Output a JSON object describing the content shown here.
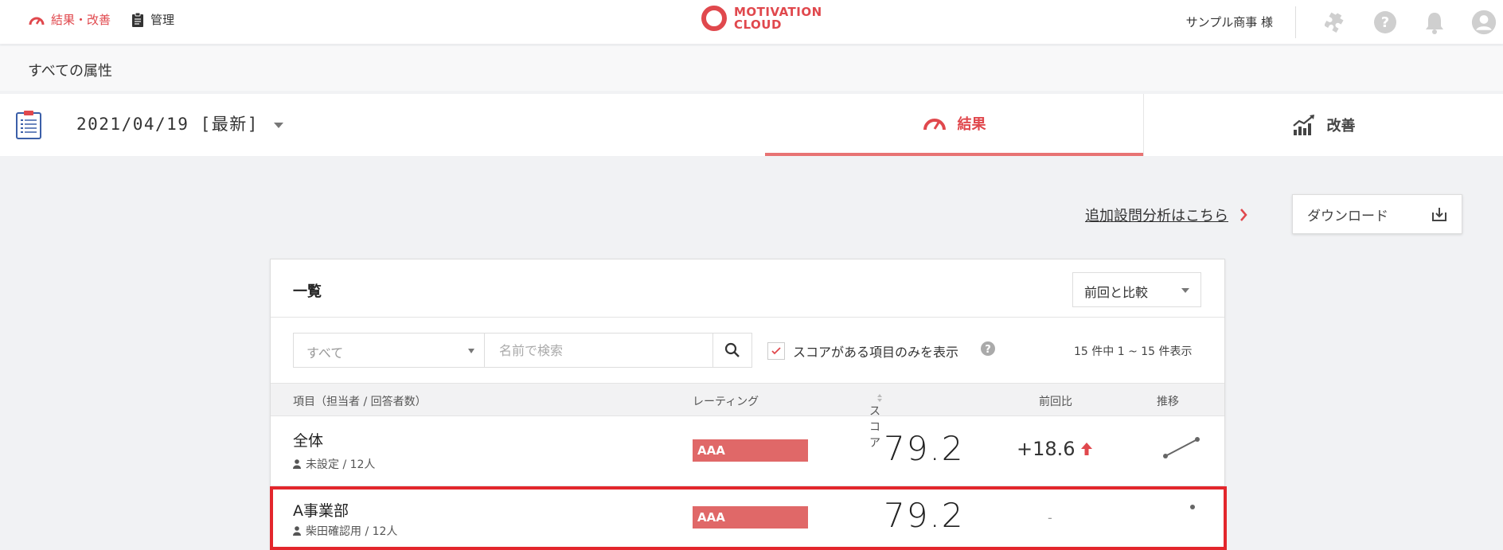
{
  "nav": {
    "results_label": "結果・改善",
    "manage_label": "管理",
    "logo_line1": "MOTIVATION",
    "logo_line2": "CLOUD",
    "company": "サンプル商事 様"
  },
  "attribute_bar": {
    "label": "すべての属性"
  },
  "survey": {
    "date_label": "2021/04/19 [最新]"
  },
  "tabs": {
    "result": "結果",
    "improve": "改善"
  },
  "actions": {
    "analysis_link": "追加設問分析はこちら",
    "download": "ダウンロード"
  },
  "list": {
    "title": "一覧",
    "compare_select": "前回と比較",
    "filter_select": "すべて",
    "search_placeholder": "名前で検索",
    "score_only_checkbox": "スコアがある項目のみを表示",
    "score_only_checked": true,
    "count_text": "15 件中 1 ~ 15 件表示",
    "columns": {
      "item": "項目（担当者 / 回答者数）",
      "rating": "レーティング",
      "score": "スコア",
      "diff": "前回比",
      "trend": "推移"
    },
    "rows": [
      {
        "name": "全体",
        "sub": "未設定 / 12人",
        "rating": "AAA",
        "score": "79.2",
        "diff": "+18.6",
        "diff_direction": "up"
      },
      {
        "name": "A事業部",
        "sub": "柴田確認用 / 12人",
        "rating": "AAA",
        "score": "79.2",
        "diff": "-",
        "diff_direction": "none"
      }
    ]
  },
  "colors": {
    "accent": "#e0484d",
    "rating_bar": "#e06868",
    "highlight": "#e3262c"
  },
  "icons": {
    "results": "gauge-icon",
    "manage": "clipboard-icon",
    "puzzle": "puzzle-icon",
    "help": "help-icon",
    "notifications": "bell-icon",
    "user": "user-icon",
    "survey": "clipboard-list-icon",
    "improve": "chart-up-icon",
    "download": "download-icon",
    "search": "search-icon"
  }
}
